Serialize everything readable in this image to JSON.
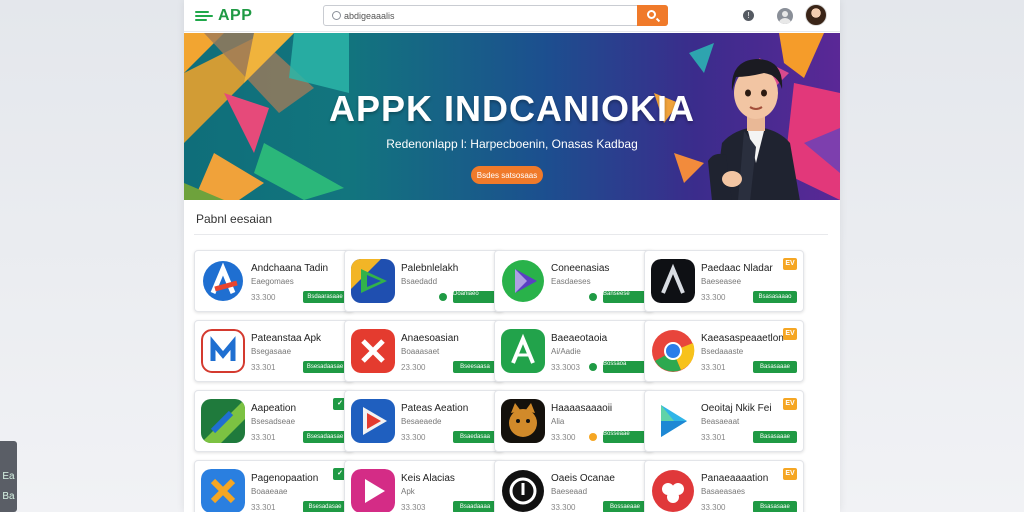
{
  "brand": {
    "name": "APP",
    "color": "#1f9a44"
  },
  "search": {
    "placeholder": "",
    "value": "abdigeaaalis",
    "icon": "search-icon"
  },
  "banner": {
    "title": "APPK INDCANIOKIA",
    "subtitle": "Redenonlapp l: Harpecboenin, Onasas Kadbag",
    "cta": "Bsdes satsosaas"
  },
  "section": {
    "title": "Pabnl eesaian"
  },
  "apps": [
    {
      "name": "Andchaana Tadin",
      "sub": "Eaegomaes",
      "size": "33.300",
      "button": "Bsdaarasaae",
      "badge": "",
      "check": "",
      "icon": "letter-a-app-icon"
    },
    {
      "name": "Palebnlelakh",
      "sub": "Bsaedadd",
      "size": "",
      "button": "",
      "badge": "",
      "check": "Doaniaeo",
      "icon": "play-tile-app-icon"
    },
    {
      "name": "Coneenasias",
      "sub": "Easdaeses",
      "size": "",
      "button": "",
      "badge": "",
      "check": "Banseese",
      "icon": "play-triangle-app-icon"
    },
    {
      "name": "Paedaac Nladar",
      "sub": "Baeseasee",
      "size": "33.300",
      "button": "Bsasasaaao",
      "badge": "EV",
      "check": "",
      "icon": "dark-a-app-icon"
    },
    {
      "name": "Pateanstaa Apk",
      "sub": "Bsegasaae",
      "size": "33.301",
      "button": "Bsesadaasae",
      "badge": "",
      "check": "",
      "icon": "m-app-icon"
    },
    {
      "name": "Anaesoasian",
      "sub": "Boaaasaet",
      "size": "23.300",
      "button": "Bseesaasa",
      "badge": "",
      "check": "",
      "icon": "x-app-icon"
    },
    {
      "name": "Baeaeotaoia",
      "sub": "Ai/Aadie",
      "size": "33.3003",
      "button": "",
      "badge": "",
      "check": "Bossaoa",
      "icon": "green-a-app-icon"
    },
    {
      "name": "Kaeasaspeaaetlon",
      "sub": "Bsedaaaste",
      "size": "33.301",
      "button": "Basasaaae",
      "badge": "EV",
      "check": "",
      "icon": "chrome-app-icon"
    },
    {
      "name": "Aapeation",
      "sub": "Bsesadseae",
      "size": "33.301",
      "button": "Bsesadaasae",
      "badge": "✓",
      "check": "",
      "icon": "pen-app-icon"
    },
    {
      "name": "Pateas Aeation",
      "sub": "Besaeaede",
      "size": "33.300",
      "button": "Bsaedasaa",
      "badge": "",
      "check": "",
      "icon": "play-store-app-icon"
    },
    {
      "name": "Haaaasaaaoii",
      "sub": "Alia",
      "size": "33.300",
      "button": "",
      "badge": "",
      "check": "Bosseaae",
      "icon": "cat-app-icon"
    },
    {
      "name": "Oeoitaj Nkik Fei",
      "sub": "Beasaeaat",
      "size": "33.301",
      "button": "Basasaaae",
      "badge": "EV",
      "check": "",
      "icon": "play-outline-app-icon"
    },
    {
      "name": "Pagenopaation",
      "sub": "Boaaeaae",
      "size": "33.301",
      "button": "Bsesadasae",
      "badge": "✓",
      "check": "",
      "icon": "tools-app-icon"
    },
    {
      "name": "Keis Alacias",
      "sub": "Apk",
      "size": "33.303",
      "button": "Bsaadaaaa",
      "badge": "",
      "check": "",
      "icon": "pink-play-app-icon"
    },
    {
      "name": "Oaeis Ocanae",
      "sub": "Baeseaad",
      "size": "33.300",
      "button": "Bossaeaae",
      "badge": "",
      "check": "",
      "icon": "dark-circle-app-icon"
    },
    {
      "name": "Panaeaaaation",
      "sub": "Basaeasaes",
      "size": "33.300",
      "button": "Bsasasaae",
      "badge": "EV",
      "check": "",
      "icon": "red-circle-app-icon"
    }
  ],
  "side": {
    "top": "Ea",
    "bottom": "Ba"
  }
}
